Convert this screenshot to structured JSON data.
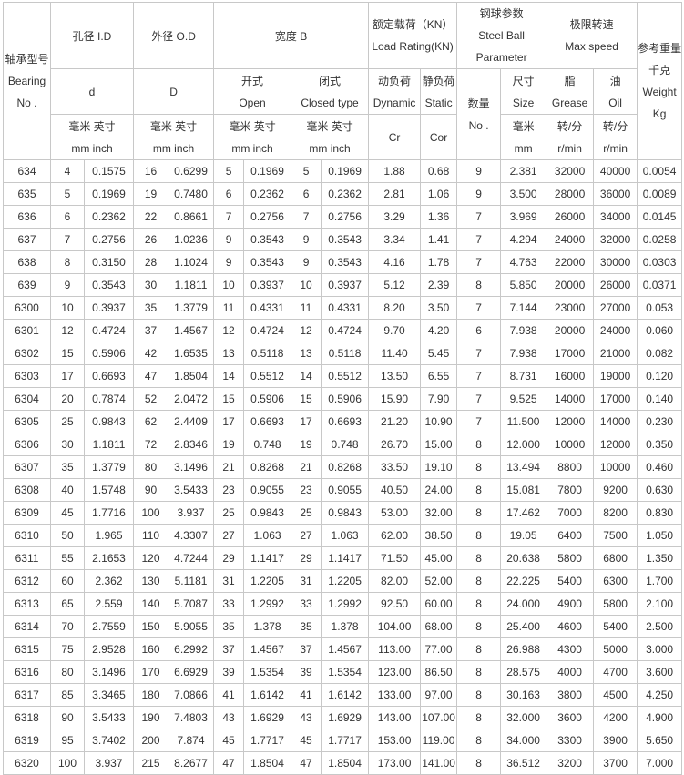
{
  "headers": {
    "bearing_no": [
      "轴承型号",
      "Bearing",
      "No ."
    ],
    "bore": "孔径 I.D",
    "outer": "外径 O.D",
    "width": "宽度 B",
    "load": [
      "额定载荷（KN）",
      "Load Rating(KN)"
    ],
    "ball": [
      "钢球参数",
      "Steel Ball",
      "Parameter"
    ],
    "speed": [
      "极限转速",
      "Max speed"
    ],
    "weight": [
      "参考重量",
      "千克",
      "Weight",
      "Kg"
    ],
    "d": "d",
    "D": "D",
    "open": [
      "开式",
      "Open"
    ],
    "closed": [
      "闭式",
      "Closed type"
    ],
    "dynamic": [
      "动负荷",
      "Dynamic"
    ],
    "static": [
      "静负荷",
      "Static"
    ],
    "qty": [
      "数量",
      "No ."
    ],
    "size": [
      "尺寸",
      "Size"
    ],
    "grease": [
      "脂",
      "Grease"
    ],
    "oil": [
      "油",
      "Oil"
    ],
    "unit_mm_inch": [
      "毫米 英寸",
      "mm inch"
    ],
    "cr": "Cr",
    "cor": "Cor",
    "unit_mm": [
      "毫米",
      "mm"
    ],
    "unit_rpm": [
      "转/分",
      "r/min"
    ]
  },
  "rows": [
    [
      "634",
      "4",
      "0.1575",
      "16",
      "0.6299",
      "5",
      "0.1969",
      "5",
      "0.1969",
      "1.88",
      "0.68",
      "9",
      "2.381",
      "32000",
      "40000",
      "0.0054"
    ],
    [
      "635",
      "5",
      "0.1969",
      "19",
      "0.7480",
      "6",
      "0.2362",
      "6",
      "0.2362",
      "2.81",
      "1.06",
      "9",
      "3.500",
      "28000",
      "36000",
      "0.0089"
    ],
    [
      "636",
      "6",
      "0.2362",
      "22",
      "0.8661",
      "7",
      "0.2756",
      "7",
      "0.2756",
      "3.29",
      "1.36",
      "7",
      "3.969",
      "26000",
      "34000",
      "0.0145"
    ],
    [
      "637",
      "7",
      "0.2756",
      "26",
      "1.0236",
      "9",
      "0.3543",
      "9",
      "0.3543",
      "3.34",
      "1.41",
      "7",
      "4.294",
      "24000",
      "32000",
      "0.0258"
    ],
    [
      "638",
      "8",
      "0.3150",
      "28",
      "1.1024",
      "9",
      "0.3543",
      "9",
      "0.3543",
      "4.16",
      "1.78",
      "7",
      "4.763",
      "22000",
      "30000",
      "0.0303"
    ],
    [
      "639",
      "9",
      "0.3543",
      "30",
      "1.1811",
      "10",
      "0.3937",
      "10",
      "0.3937",
      "5.12",
      "2.39",
      "8",
      "5.850",
      "20000",
      "26000",
      "0.0371"
    ],
    [
      "6300",
      "10",
      "0.3937",
      "35",
      "1.3779",
      "11",
      "0.4331",
      "11",
      "0.4331",
      "8.20",
      "3.50",
      "7",
      "7.144",
      "23000",
      "27000",
      "0.053"
    ],
    [
      "6301",
      "12",
      "0.4724",
      "37",
      "1.4567",
      "12",
      "0.4724",
      "12",
      "0.4724",
      "9.70",
      "4.20",
      "6",
      "7.938",
      "20000",
      "24000",
      "0.060"
    ],
    [
      "6302",
      "15",
      "0.5906",
      "42",
      "1.6535",
      "13",
      "0.5118",
      "13",
      "0.5118",
      "11.40",
      "5.45",
      "7",
      "7.938",
      "17000",
      "21000",
      "0.082"
    ],
    [
      "6303",
      "17",
      "0.6693",
      "47",
      "1.8504",
      "14",
      "0.5512",
      "14",
      "0.5512",
      "13.50",
      "6.55",
      "7",
      "8.731",
      "16000",
      "19000",
      "0.120"
    ],
    [
      "6304",
      "20",
      "0.7874",
      "52",
      "2.0472",
      "15",
      "0.5906",
      "15",
      "0.5906",
      "15.90",
      "7.90",
      "7",
      "9.525",
      "14000",
      "17000",
      "0.140"
    ],
    [
      "6305",
      "25",
      "0.9843",
      "62",
      "2.4409",
      "17",
      "0.6693",
      "17",
      "0.6693",
      "21.20",
      "10.90",
      "7",
      "11.500",
      "12000",
      "14000",
      "0.230"
    ],
    [
      "6306",
      "30",
      "1.1811",
      "72",
      "2.8346",
      "19",
      "0.748",
      "19",
      "0.748",
      "26.70",
      "15.00",
      "8",
      "12.000",
      "10000",
      "12000",
      "0.350"
    ],
    [
      "6307",
      "35",
      "1.3779",
      "80",
      "3.1496",
      "21",
      "0.8268",
      "21",
      "0.8268",
      "33.50",
      "19.10",
      "8",
      "13.494",
      "8800",
      "10000",
      "0.460"
    ],
    [
      "6308",
      "40",
      "1.5748",
      "90",
      "3.5433",
      "23",
      "0.9055",
      "23",
      "0.9055",
      "40.50",
      "24.00",
      "8",
      "15.081",
      "7800",
      "9200",
      "0.630"
    ],
    [
      "6309",
      "45",
      "1.7716",
      "100",
      "3.937",
      "25",
      "0.9843",
      "25",
      "0.9843",
      "53.00",
      "32.00",
      "8",
      "17.462",
      "7000",
      "8200",
      "0.830"
    ],
    [
      "6310",
      "50",
      "1.965",
      "110",
      "4.3307",
      "27",
      "1.063",
      "27",
      "1.063",
      "62.00",
      "38.50",
      "8",
      "19.05",
      "6400",
      "7500",
      "1.050"
    ],
    [
      "6311",
      "55",
      "2.1653",
      "120",
      "4.7244",
      "29",
      "1.1417",
      "29",
      "1.1417",
      "71.50",
      "45.00",
      "8",
      "20.638",
      "5800",
      "6800",
      "1.350"
    ],
    [
      "6312",
      "60",
      "2.362",
      "130",
      "5.1181",
      "31",
      "1.2205",
      "31",
      "1.2205",
      "82.00",
      "52.00",
      "8",
      "22.225",
      "5400",
      "6300",
      "1.700"
    ],
    [
      "6313",
      "65",
      "2.559",
      "140",
      "5.7087",
      "33",
      "1.2992",
      "33",
      "1.2992",
      "92.50",
      "60.00",
      "8",
      "24.000",
      "4900",
      "5800",
      "2.100"
    ],
    [
      "6314",
      "70",
      "2.7559",
      "150",
      "5.9055",
      "35",
      "1.378",
      "35",
      "1.378",
      "104.00",
      "68.00",
      "8",
      "25.400",
      "4600",
      "5400",
      "2.500"
    ],
    [
      "6315",
      "75",
      "2.9528",
      "160",
      "6.2992",
      "37",
      "1.4567",
      "37",
      "1.4567",
      "113.00",
      "77.00",
      "8",
      "26.988",
      "4300",
      "5000",
      "3.000"
    ],
    [
      "6316",
      "80",
      "3.1496",
      "170",
      "6.6929",
      "39",
      "1.5354",
      "39",
      "1.5354",
      "123.00",
      "86.50",
      "8",
      "28.575",
      "4000",
      "4700",
      "3.600"
    ],
    [
      "6317",
      "85",
      "3.3465",
      "180",
      "7.0866",
      "41",
      "1.6142",
      "41",
      "1.6142",
      "133.00",
      "97.00",
      "8",
      "30.163",
      "3800",
      "4500",
      "4.250"
    ],
    [
      "6318",
      "90",
      "3.5433",
      "190",
      "7.4803",
      "43",
      "1.6929",
      "43",
      "1.6929",
      "143.00",
      "107.00",
      "8",
      "32.000",
      "3600",
      "4200",
      "4.900"
    ],
    [
      "6319",
      "95",
      "3.7402",
      "200",
      "7.874",
      "45",
      "1.7717",
      "45",
      "1.7717",
      "153.00",
      "119.00",
      "8",
      "34.000",
      "3300",
      "3900",
      "5.650"
    ],
    [
      "6320",
      "100",
      "3.937",
      "215",
      "8.2677",
      "47",
      "1.8504",
      "47",
      "1.8504",
      "173.00",
      "141.00",
      "8",
      "36.512",
      "3200",
      "3700",
      "7.000"
    ]
  ]
}
